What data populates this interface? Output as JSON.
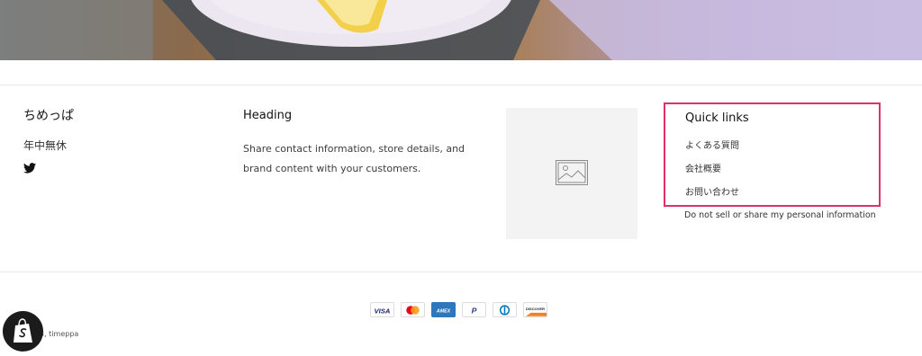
{
  "brand": {
    "name": "ちめっぱ",
    "tagline": "年中無休",
    "social_icons": [
      "twitter-icon"
    ]
  },
  "heading_block": {
    "title": "Heading",
    "text": "Share contact information, store details, and brand content with your customers."
  },
  "image_block": {
    "icon": "image-placeholder-icon"
  },
  "quick_links": {
    "title": "Quick links",
    "items": [
      {
        "label": "よくある質問"
      },
      {
        "label": "会社概要"
      },
      {
        "label": "お問い合わせ"
      }
    ],
    "highlight_color": "#e0306e"
  },
  "privacy_link": "Do not sell or share my personal information",
  "payment_methods": [
    "Visa",
    "Mastercard",
    "American Express",
    "PayPal",
    "Diners Club",
    "Discover"
  ],
  "copyright": "3, timeppa",
  "badge": {
    "icon": "shopify-icon"
  }
}
